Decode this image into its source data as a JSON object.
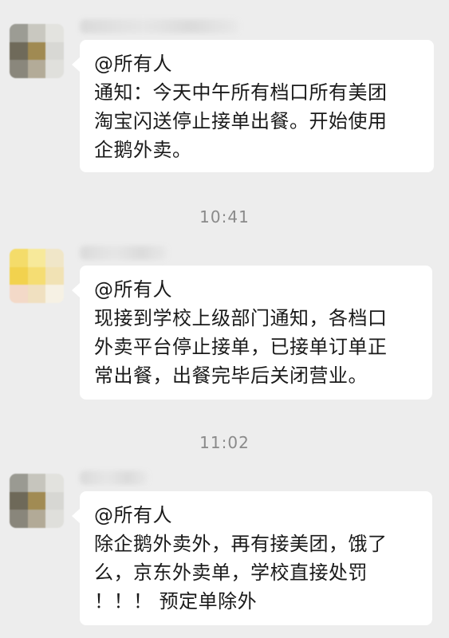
{
  "messages": [
    {
      "mention": "@所有人",
      "lines": [
        "通知：今天中午所有档口所有美团",
        "淘宝闪送停止接单出餐。开始使用",
        "企鹅外卖。"
      ]
    },
    {
      "mention": "@所有人",
      "lines": [
        "现接到学校上级部门通知，各档口",
        "外卖平台停止接单，已接单订单正",
        "常出餐，出餐完毕后关闭营业。"
      ]
    },
    {
      "mention": "@所有人",
      "lines": [
        "除企鹅外卖外，再有接美团，饿了",
        "么，京东外卖单，学校直接处罚",
        "！！！ 预定单除外"
      ]
    }
  ],
  "timestamps": [
    "10:41",
    "11:02"
  ],
  "colors": {
    "background": "#ededed",
    "bubble": "#ffffff",
    "text": "#1a1a1a",
    "timestamp": "#8a8a8a"
  }
}
